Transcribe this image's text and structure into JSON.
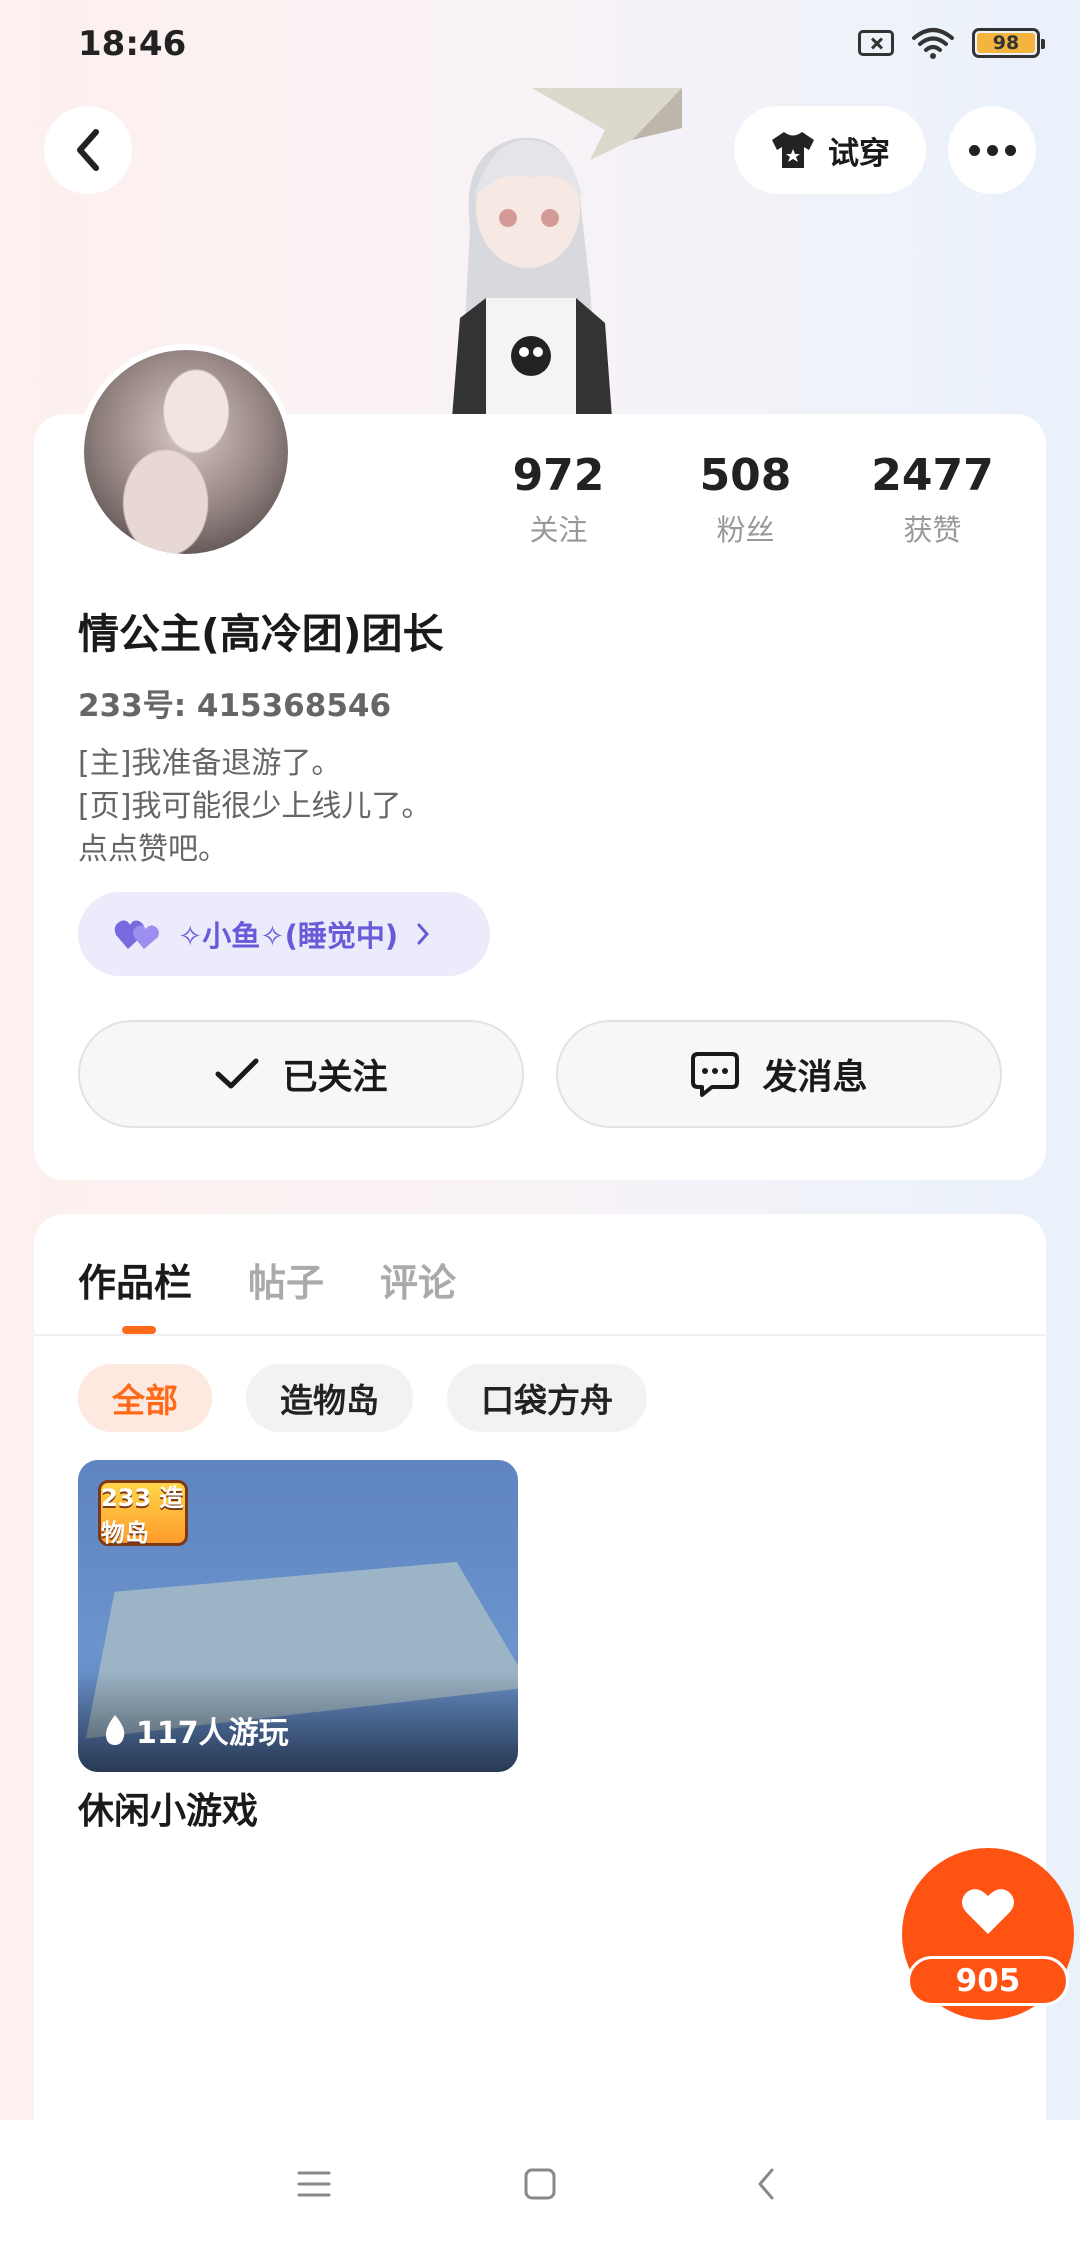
{
  "status_bar": {
    "time": "18:46",
    "battery": "98"
  },
  "header": {
    "tryon_label": "试穿"
  },
  "profile": {
    "stats": [
      {
        "value": "972",
        "label": "关注"
      },
      {
        "value": "508",
        "label": "粉丝"
      },
      {
        "value": "2477",
        "label": "获赞"
      }
    ],
    "nickname": "情公主(高冷团)团长",
    "uid": "233号: 415368546",
    "bio": [
      "[主]我准备退游了。",
      "[页]我可能很少上线儿了。",
      "点点赞吧。"
    ],
    "cp_name": "✧小鱼✧(睡觉中)",
    "follow_label": "已关注",
    "message_label": "发消息"
  },
  "works": {
    "tabs": [
      "作品栏",
      "帖子",
      "评论"
    ],
    "active_tab": "作品栏",
    "chips": [
      "全部",
      "造物岛",
      "口袋方舟"
    ],
    "game_logo_text": "233 造物岛",
    "game_play_count": "117人游玩",
    "game_title": "休闲小游戏"
  },
  "like_count": "905",
  "colors": {
    "accent": "#ff5314",
    "cp_badge": "#ecebfb",
    "cp_text": "#6a5ad9"
  }
}
